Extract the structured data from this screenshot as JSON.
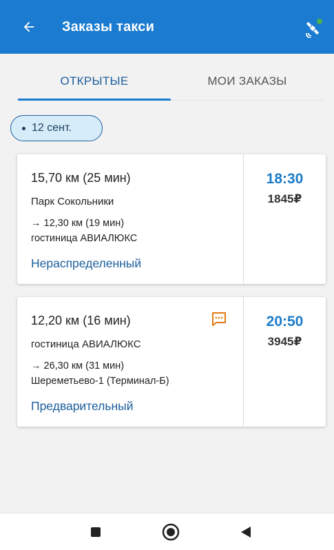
{
  "appbar": {
    "title": "Заказы такси",
    "back_icon": "arrow-left-icon",
    "satellite_icon": "satellite-icon",
    "status_dot_color": "#4caf50",
    "bg_color": "#1a7bd0"
  },
  "tabs": [
    {
      "label": "ОТКРЫТЫЕ",
      "active": true
    },
    {
      "label": "МОИ ЗАКАЗЫ",
      "active": false
    }
  ],
  "date_chip": {
    "label": "12 сент."
  },
  "orders": [
    {
      "distance": "15,70 км (25 мин)",
      "from": "Парк Сокольники",
      "route": "→ 12,30 км (19 мин)",
      "to": "гостиница АВИАЛЮКС",
      "status": "Нераспределенный",
      "time": "18:30",
      "price": "1845₽",
      "has_message": false
    },
    {
      "distance": "12,20 км (16 мин)",
      "from": "гостиница АВИАЛЮКС",
      "route": "→ 26,30 км (31 мин)",
      "to": "Шереметьево-1 (Терминал-Б)",
      "status": "Предварительный",
      "time": "20:50",
      "price": "3945₽",
      "has_message": true,
      "message_icon": "chat-icon",
      "message_icon_color": "#e07a10"
    }
  ],
  "nav": {
    "recents_icon": "square-icon",
    "home_icon": "circle-icon",
    "back_icon": "triangle-back-icon"
  }
}
